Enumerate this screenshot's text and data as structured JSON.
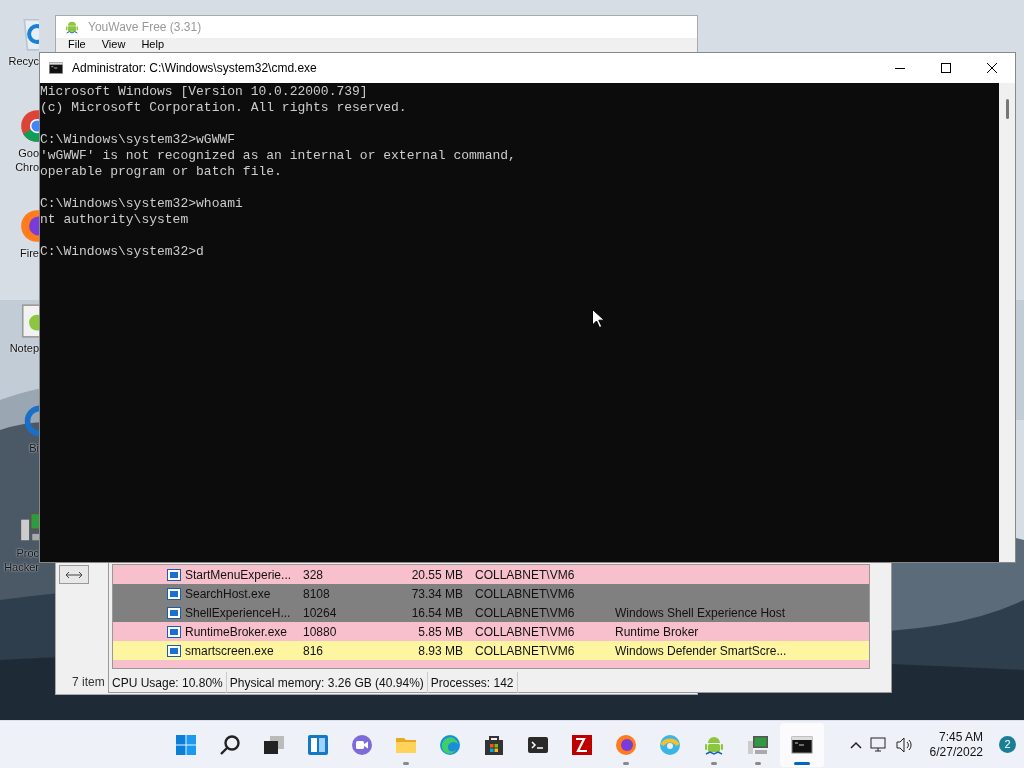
{
  "desktop_icons": [
    {
      "kind": "recycle",
      "lines": [
        "Recyc"
      ]
    },
    {
      "kind": "chrome",
      "lines": [
        "Goo",
        "Chro"
      ]
    },
    {
      "kind": "firefox",
      "lines": [
        "Fire"
      ]
    },
    {
      "kind": "notepad",
      "lines": [
        "Notep"
      ]
    },
    {
      "kind": "ring",
      "lines": [
        "Bi"
      ]
    },
    {
      "kind": "hacker",
      "lines": [
        "Proc",
        "Hacker"
      ]
    }
  ],
  "youwave": {
    "title": "YouWave Free (3.31)",
    "menu": [
      "File",
      "View",
      "Help"
    ],
    "status": "7 item"
  },
  "process_hacker": {
    "rows": [
      {
        "name": "StartMenuExperie...",
        "pid": "328",
        "memory": "20.55 MB",
        "user": "COLLABNET\\VM6",
        "color": "#f8c0cc"
      },
      {
        "name": "SearchHost.exe",
        "pid": "8108",
        "memory": "73.34 MB",
        "user": "COLLABNET\\VM6",
        "color": "#808080"
      },
      {
        "name": "ShellExperienceH...",
        "pid": "10264",
        "memory": "16.54 MB",
        "user": "COLLABNET\\VM6",
        "description": "Windows Shell Experience Host",
        "color": "#808080"
      },
      {
        "name": "RuntimeBroker.exe",
        "pid": "10880",
        "memory": "5.85 MB",
        "user": "COLLABNET\\VM6",
        "description": "Runtime Broker",
        "color": "#f8c0cc"
      },
      {
        "name": "smartscreen.exe",
        "pid": "816",
        "memory": "8.93 MB",
        "user": "COLLABNET\\VM6",
        "description": "Windows Defender SmartScre...",
        "color": "#fdf5a0"
      }
    ],
    "status": [
      "CPU Usage: 10.80%",
      "Physical memory: 3.26 GB (40.94%)",
      "Processes: 142"
    ]
  },
  "cmd": {
    "title": "Administrator: C:\\Windows\\system32\\cmd.exe",
    "blocks": [
      [
        "Microsoft Windows [Version 10.0.22000.739]",
        "(c) Microsoft Corporation. All rights reserved."
      ],
      [
        "C:\\Windows\\system32>wGWWF",
        "'wGWWF' is not recognized as an internal or external command,",
        "operable program or batch file."
      ],
      [
        "C:\\Windows\\system32>whoami",
        "nt authority\\system"
      ],
      [
        "C:\\Windows\\system32>d"
      ]
    ]
  },
  "taskbar": {
    "apps": [
      {
        "kind": "start",
        "running": false,
        "active": false
      },
      {
        "kind": "search",
        "running": false,
        "active": false
      },
      {
        "kind": "taskview",
        "running": false,
        "active": false
      },
      {
        "kind": "widgets",
        "running": false,
        "active": false
      },
      {
        "kind": "chat",
        "running": false,
        "active": false
      },
      {
        "kind": "folder",
        "running": true,
        "active": false
      },
      {
        "kind": "edge",
        "running": false,
        "active": false
      },
      {
        "kind": "store",
        "running": false,
        "active": false
      },
      {
        "kind": "terminal",
        "running": false,
        "active": false
      },
      {
        "kind": "filezilla",
        "running": false,
        "active": false
      },
      {
        "kind": "firefox",
        "running": true,
        "active": false
      },
      {
        "kind": "swirl",
        "running": false,
        "active": false
      },
      {
        "kind": "android",
        "running": true,
        "active": false
      },
      {
        "kind": "hacker",
        "running": true,
        "active": false
      },
      {
        "kind": "console",
        "running": true,
        "active": true
      }
    ],
    "time": "7:45 AM",
    "date": "6/27/2022",
    "notifications": "2"
  }
}
